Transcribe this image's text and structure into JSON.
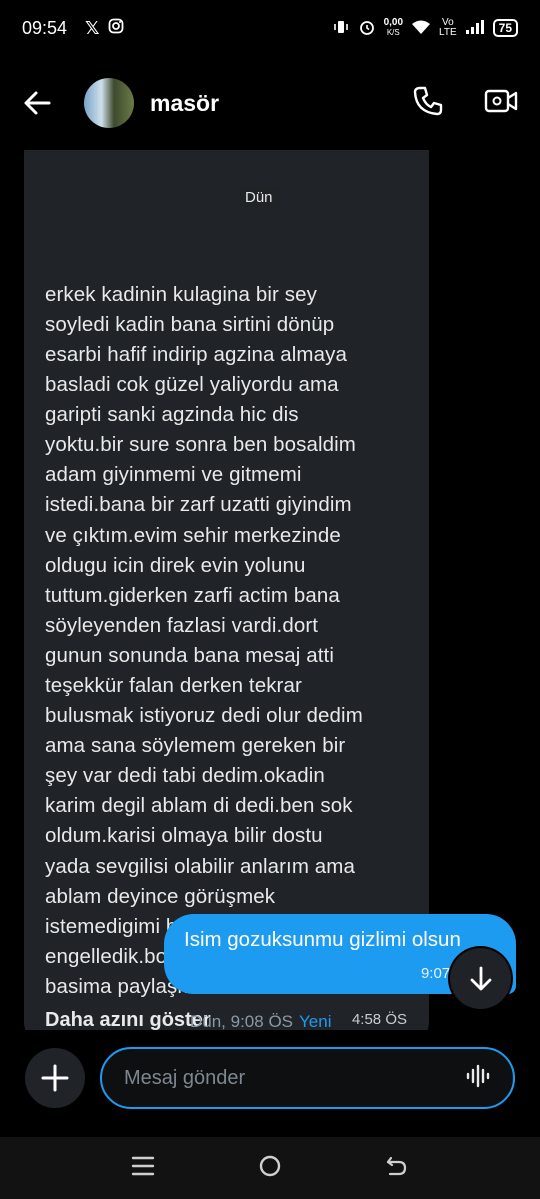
{
  "status_bar": {
    "time": "09:54",
    "net_speed": "0,00",
    "net_unit": "K/S",
    "net_type_top": "Vo",
    "net_type_bottom": "LTE",
    "battery": "75"
  },
  "header": {
    "contact_name": "masör",
    "icons": [
      "back-arrow-icon",
      "phone-icon",
      "video-call-icon"
    ]
  },
  "conversation": {
    "day_label": "Dün",
    "incoming_message": {
      "text": "erkek kadinin kulagina bir sey\nsoyledi kadin bana sirtini dönüp\nesarbi hafif indirip agzina almaya\nbasladi cok güzel yaliyordu ama\ngaripti sanki agzinda hic dis\nyoktu.bir sure sonra ben bosaldim\nadam giyinmemi ve gitmemi\nistedi.bana bir zarf uzatti  giyindim\nve çıktım.evim sehir merkezinde\noldugu icin direk evin yolunu\ntuttum.giderken zarfi actim bana\nsöyleyenden fazlasi vardi.dort\ngunun sonunda bana mesaj atti\nteşekkür falan derken tekrar\nbulusmak istiyoruz dedi olur dedim\nama sana söylemem gereken bir\nşey var dedi tabi dedim.okadin\nkarim degil ablam di dedi.ben sok\noldum.karisi olmaya bilir dostu\nyada sevgilisi olabilir anlarım ama\nablam deyince görüşmek\nistemedigimi belirtip bir birimizi\nengelledik.boyle bir olay geldi\nbasima paylaşmak istedim.",
      "toggle_label": "Daha azını göster",
      "time": "4:58 ÖS"
    },
    "outgoing_message": {
      "text": "Isim gozuksunmu gizlimi olsun",
      "time": "9:07 ÖS"
    },
    "read_receipt": {
      "text": "Dün, 9:08 ÖS",
      "new_label": "Yeni"
    }
  },
  "composer": {
    "placeholder": "Mesaj gönder"
  },
  "colors": {
    "accent": "#1d9bf0",
    "incoming_bubble": "#202327",
    "background": "#000000"
  }
}
